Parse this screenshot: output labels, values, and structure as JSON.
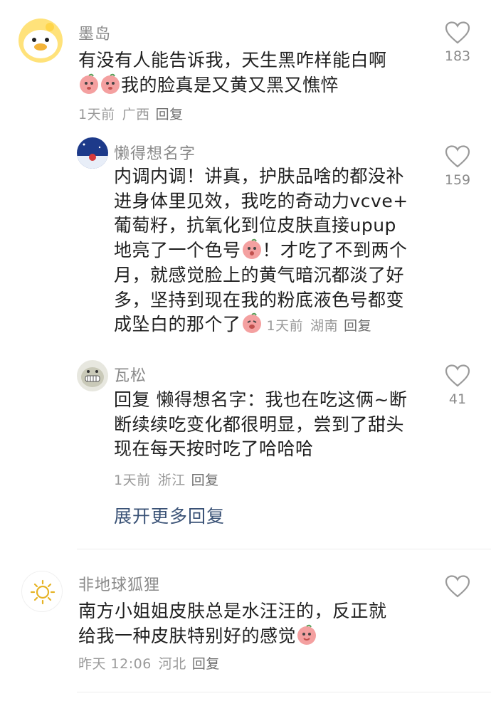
{
  "comments": [
    {
      "name": "墨岛",
      "text1": "有没有人能告诉我，天生黑咋样能白啊",
      "text2": "我的脸真是又黄又黑又憔悴",
      "time": "1天前",
      "location": "广西",
      "reply": "回复",
      "likes": "183"
    },
    {
      "name": "懒得想名字",
      "lines": [
        "内调内调！讲真，护肤品啥的都没补",
        "进身体里见效，我吃的奇动力vcve+",
        "葡萄籽，抗氧化到位皮肤直接upup",
        "地亮了一个色号",
        "！才吃了不到两个",
        "月，就感觉脸上的黄气暗沉都淡了好",
        "多，坚持到现在我的粉底液色号都变",
        "成坠白的那个了"
      ],
      "time": "1天前",
      "location": "湖南",
      "reply": "回复",
      "likes": "159"
    },
    {
      "name": "瓦松",
      "lines": [
        "回复 懒得想名字：我也在吃这俩~断",
        "断续续吃变化都很明显，尝到了甜头",
        "现在每天按时吃了哈哈哈"
      ],
      "time": "1天前",
      "location": "浙江",
      "reply": "回复",
      "likes": "41"
    },
    {
      "name": "非地球狐狸",
      "lines": [
        "南方小姐姐皮肤总是水汪汪的，反正就",
        "给我一种皮肤特别好的感觉"
      ],
      "time": "昨天 12:06",
      "location": "河北",
      "reply": "回复",
      "likes": ""
    }
  ],
  "expand_more": "展开更多回复",
  "colors": {
    "text": "#1f1f1f",
    "meta": "#9a9a9a",
    "link": "#3a5276",
    "emoji_pink": "#f4a0a0"
  },
  "icons": [
    "heart-outline-icon",
    "peach-emoji-icon"
  ]
}
